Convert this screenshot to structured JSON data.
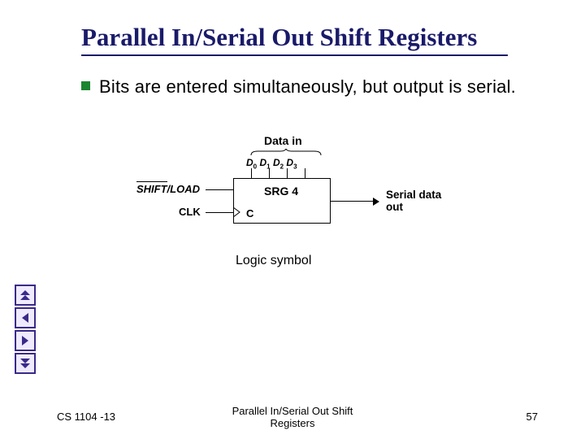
{
  "title": "Parallel In/Serial Out Shift Registers",
  "bullet": "Bits are entered simultaneously, but output is serial.",
  "figure": {
    "data_in": "Data in",
    "d0": "D",
    "d0s": "0",
    "d1": "D",
    "d1s": "1",
    "d2": "D",
    "d2s": "2",
    "d3": "D",
    "d3s": "3",
    "srg": "SRG 4",
    "c": "C",
    "shift_load": "SHIFT/LOAD",
    "clk": "CLK",
    "serial_out": "Serial data out",
    "caption": "Logic symbol"
  },
  "footer": {
    "left": "CS 1104 -13",
    "center": "Parallel In/Serial Out Shift Registers",
    "page": "57"
  }
}
